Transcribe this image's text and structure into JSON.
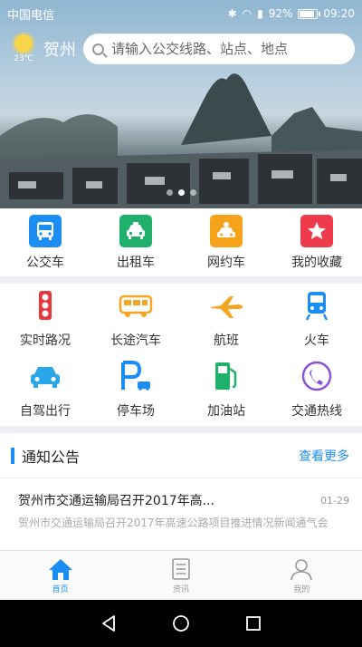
{
  "status_bar": {
    "carrier": "中国电信",
    "battery": "92%",
    "battery_level": 0.92,
    "time": "09:20"
  },
  "header": {
    "temperature": "23℃",
    "city": "贺州",
    "search_placeholder": "请输入公交线路、站点、地点"
  },
  "banner": {
    "slide_count": 3,
    "active_slide": 2
  },
  "primary_services": [
    {
      "label": "公交车",
      "icon": "bus-icon",
      "color": "#1c8df2"
    },
    {
      "label": "出租车",
      "icon": "taxi-icon",
      "color": "#1fb06b"
    },
    {
      "label": "网约车",
      "icon": "ride-hailing-icon",
      "color": "#f7a21b"
    },
    {
      "label": "我的收藏",
      "icon": "star-icon",
      "color": "#ee3a4a"
    }
  ],
  "secondary_services": [
    {
      "label": "实时路况",
      "icon": "traffic-light-icon",
      "color": "#e8383d"
    },
    {
      "label": "长途汽车",
      "icon": "coach-icon",
      "color": "#f5a623"
    },
    {
      "label": "航班",
      "icon": "airplane-icon",
      "color": "#f5a623"
    },
    {
      "label": "火车",
      "icon": "train-icon",
      "color": "#1c8df2"
    },
    {
      "label": "自驾出行",
      "icon": "car-icon",
      "color": "#29a6e8"
    },
    {
      "label": "停车场",
      "icon": "parking-icon",
      "color": "#1c8df2"
    },
    {
      "label": "加油站",
      "icon": "gas-station-icon",
      "color": "#1fb06b"
    },
    {
      "label": "交通热线",
      "icon": "phone-icon",
      "color": "#8b52d6"
    }
  ],
  "notice": {
    "title": "通知公告",
    "more": "查看更多",
    "items": [
      {
        "headline": "贺州市交通运输局召开2017年高...",
        "date": "01-29",
        "summary": "贺州市交通运输局召开2017年高速公路项目推进情况新闻通气会"
      }
    ]
  },
  "tabbar": [
    {
      "label": "首页",
      "icon": "home-icon",
      "active": true
    },
    {
      "label": "资讯",
      "icon": "news-icon",
      "active": false
    },
    {
      "label": "我的",
      "icon": "user-icon",
      "active": false
    }
  ],
  "colors": {
    "accent": "#1c8df2"
  }
}
